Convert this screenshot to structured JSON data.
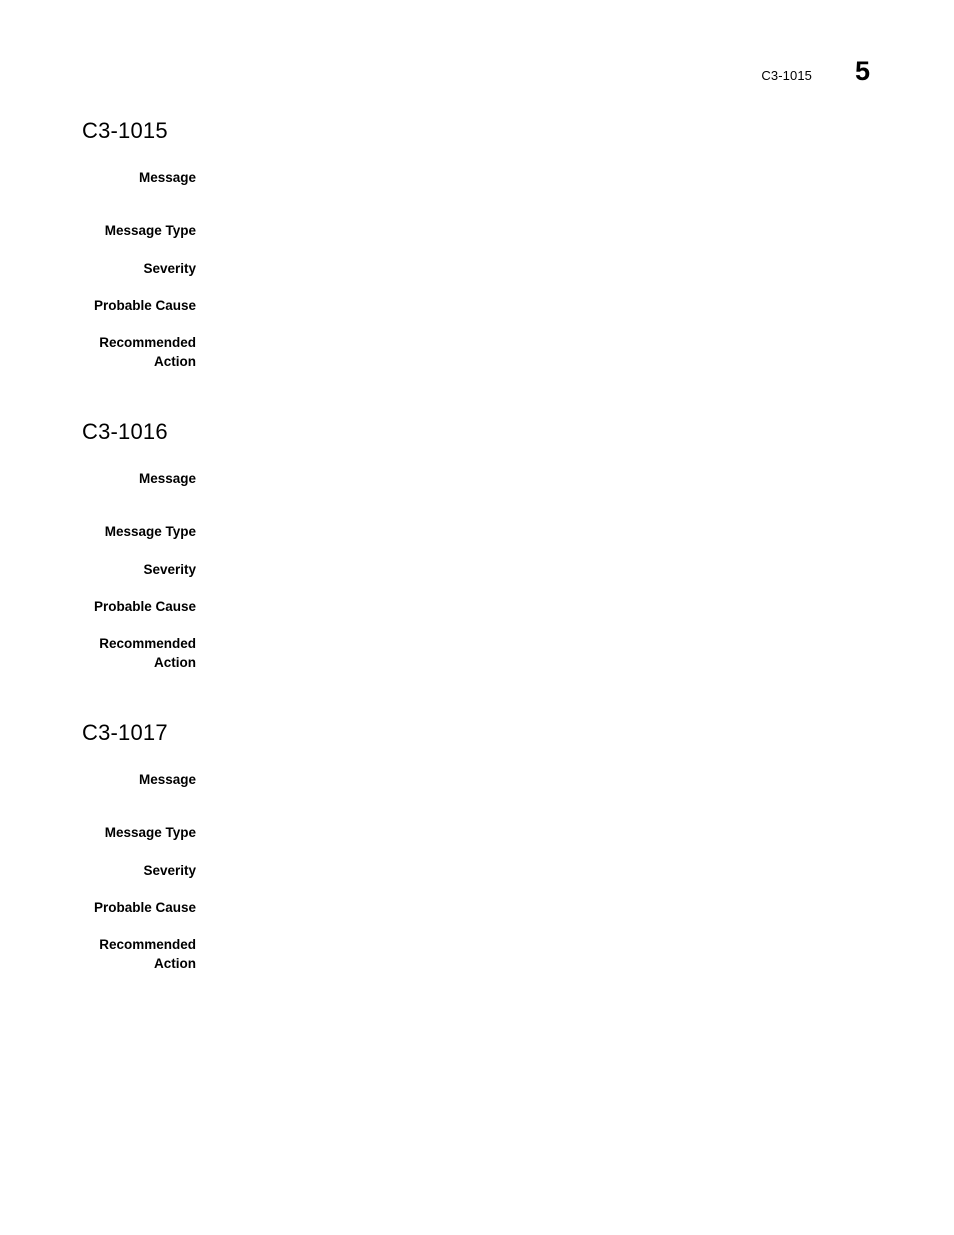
{
  "page": {
    "header": {
      "running_title": "C3-1015",
      "page_number": "5"
    }
  },
  "field_labels": {
    "message": "Message",
    "message_type": "Message Type",
    "severity": "Severity",
    "probable_cause": "Probable Cause",
    "recommended_action": "Recommended\nAction"
  },
  "sections": [
    {
      "heading": "C3-1015",
      "fields": {
        "message": "",
        "message_type": "",
        "severity": "",
        "probable_cause": "",
        "recommended_action": ""
      }
    },
    {
      "heading": "C3-1016",
      "fields": {
        "message": "",
        "message_type": "",
        "severity": "",
        "probable_cause": "",
        "recommended_action": ""
      }
    },
    {
      "heading": "C3-1017",
      "fields": {
        "message": "",
        "message_type": "",
        "severity": "",
        "probable_cause": "",
        "recommended_action": ""
      }
    }
  ]
}
